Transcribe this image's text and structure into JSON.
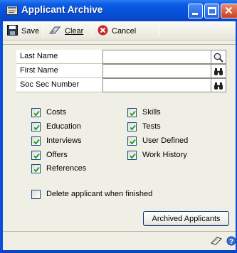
{
  "window": {
    "title": "Applicant Archive",
    "accent": "#0a4fd6",
    "icons": [
      "window-app-icon",
      "minimize-icon",
      "maximize-icon",
      "close-icon"
    ]
  },
  "toolbar": {
    "save_label": "Save",
    "clear_label": "Clear",
    "cancel_label": "Cancel",
    "icons": [
      "save-disk-icon",
      "clear-eraser-icon",
      "cancel-x-icon"
    ]
  },
  "fields": [
    {
      "label": "Last Name",
      "value": "",
      "lookup_icon": "magnifier-icon"
    },
    {
      "label": "First Name",
      "value": "",
      "lookup_icon": "binoculars-icon"
    },
    {
      "label": "Soc Sec Number",
      "value": "",
      "lookup_icon": "binoculars-icon"
    }
  ],
  "options": {
    "left": [
      {
        "label": "Costs",
        "checked": true
      },
      {
        "label": "Education",
        "checked": true
      },
      {
        "label": "Interviews",
        "checked": true
      },
      {
        "label": "Offers",
        "checked": true
      },
      {
        "label": "References",
        "checked": true
      }
    ],
    "right": [
      {
        "label": "Skills",
        "checked": true
      },
      {
        "label": "Tests",
        "checked": true
      },
      {
        "label": "User Defined",
        "checked": true
      },
      {
        "label": "Work History",
        "checked": true
      }
    ]
  },
  "delete_option": {
    "label": "Delete applicant when finished",
    "checked": false
  },
  "archived_button_label": "Archived Applicants",
  "statusbar": {
    "icons": [
      "note-icon",
      "help-icon"
    ]
  }
}
